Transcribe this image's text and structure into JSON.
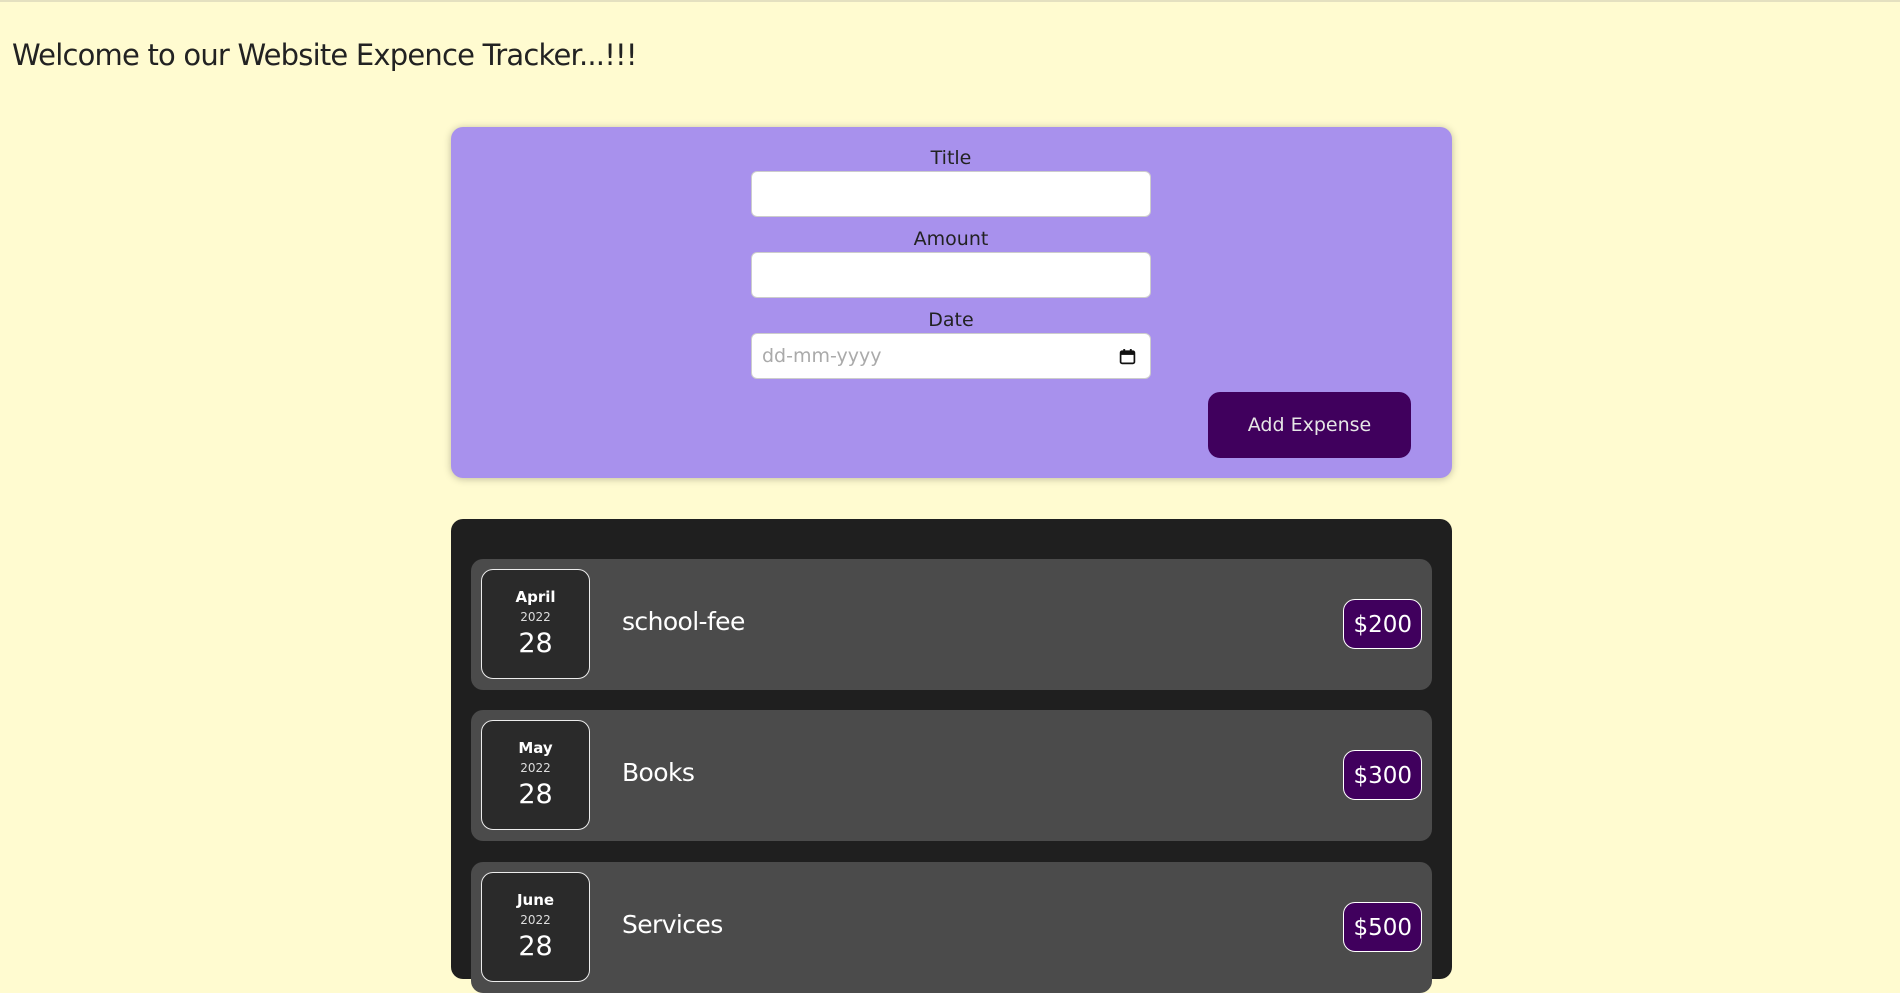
{
  "header": {
    "title": "Welcome to our Website Expence Tracker...!!!"
  },
  "form": {
    "title_label": "Title",
    "title_value": "",
    "amount_label": "Amount",
    "amount_value": "",
    "date_label": "Date",
    "date_placeholder": "dd-mm-yyyy",
    "submit_label": "Add Expense"
  },
  "expenses": [
    {
      "month": "April",
      "year": "2022",
      "day": "28",
      "title": "school-fee",
      "amount": "$200"
    },
    {
      "month": "May",
      "year": "2022",
      "day": "28",
      "title": "Books",
      "amount": "$300"
    },
    {
      "month": "June",
      "year": "2022",
      "day": "28",
      "title": "Services",
      "amount": "$500"
    }
  ],
  "colors": {
    "page_bg": "#fffbd0",
    "form_bg": "#a891ed",
    "button_bg": "#40005d",
    "list_bg": "#1f1f1f",
    "item_bg": "#4b4b4b"
  },
  "icons": {
    "date_picker": "calendar-icon"
  }
}
